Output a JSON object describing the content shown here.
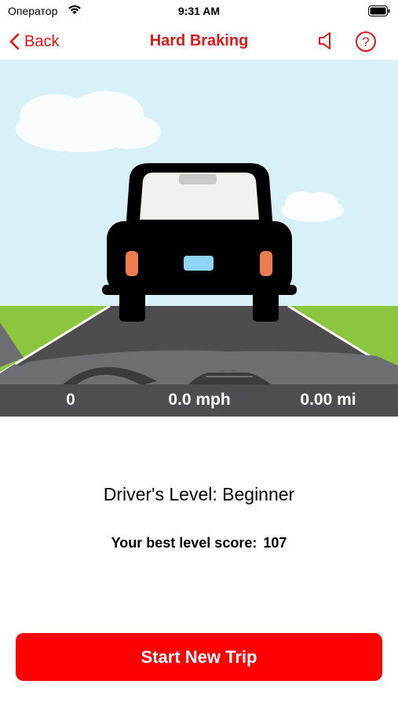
{
  "status_bar": {
    "carrier": "Оператор",
    "time": "9:31 AM"
  },
  "nav": {
    "back_label": "Back",
    "title": "Hard Braking",
    "sound_icon": "speaker-icon",
    "help_icon": "question-circle-icon"
  },
  "readouts": {
    "count": "0",
    "speed": "0.0 mph",
    "distance": "0.00 mi"
  },
  "info": {
    "driver_level": "Driver's Level: Beginner",
    "best_score_label": "Your best level score:",
    "best_score_value": "107"
  },
  "actions": {
    "start_label": "Start New Trip"
  },
  "colors": {
    "accent": "#ff0000",
    "title": "#e21717",
    "sky": "#d8f0f8",
    "grass": "#8cc63f",
    "road": "#4d4d4f"
  }
}
